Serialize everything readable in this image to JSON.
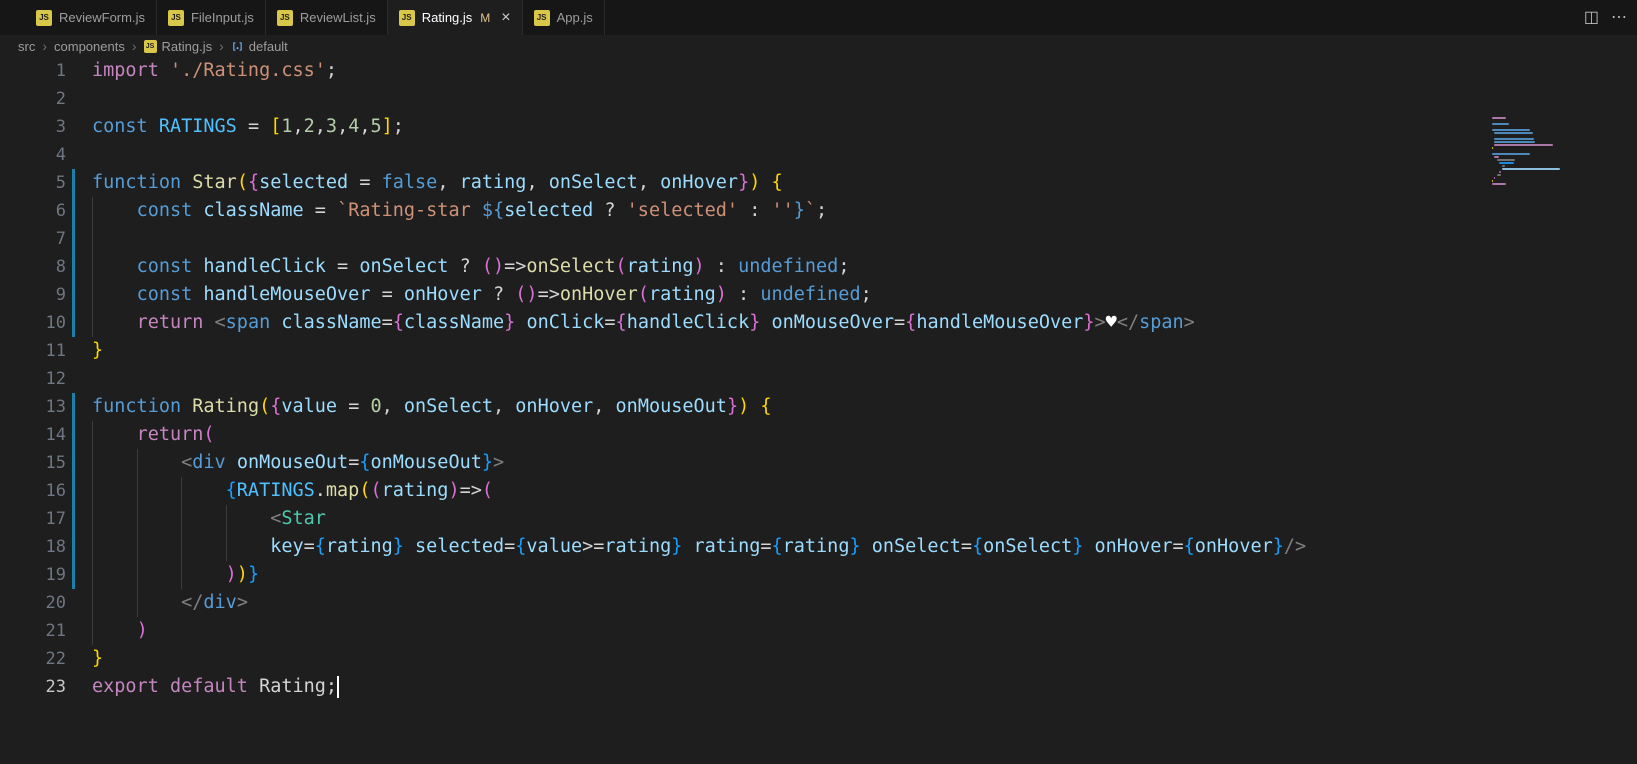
{
  "palette": {
    "ui": {
      "editor_bg": "#1e1e1e",
      "tabbar_bg": "#161616",
      "tab_active_bg": "#1e1e1e",
      "tab_border": "#2a2a2a",
      "tab_fg": "#9d9d9d",
      "tab_active_fg": "#ffffff",
      "modified": "#e2c08d",
      "breadcrumb_fg": "#9d9d9d",
      "breadcrumb_sep": "#6f6f6f",
      "line_no": "#6e7681",
      "line_no_active": "#c8c8c8",
      "guide": "#3b3b3b",
      "change_bar": "#1b81a8",
      "cursor": "#ffffff",
      "js_icon_bg": "#d9c749",
      "js_icon_fg": "#1e1e1e",
      "action_fg": "#bdbdbd",
      "symbol_icon": "#75beff"
    },
    "syntax": {
      "fg": "#d4d4d4",
      "kw1": "#c586c0",
      "kw2": "#569cd6",
      "fn": "#dcdcaa",
      "cmp": "#4ec9b0",
      "var": "#9cdcfe",
      "cnst": "#4fc1ff",
      "num": "#b5cea8",
      "str": "#ce9178",
      "tag": "#569cd6",
      "pk": "#808080",
      "b1": "#ffd700",
      "b2": "#da70d6",
      "b3": "#179fff",
      "hrt": "#ffffff"
    }
  },
  "tab_bar": {
    "icon_text": "JS",
    "tabs": [
      {
        "label": "ReviewForm.js",
        "active": false
      },
      {
        "label": "FileInput.js",
        "active": false
      },
      {
        "label": "ReviewList.js",
        "active": false
      },
      {
        "label": "Rating.js",
        "active": true,
        "git_status": "M",
        "close_glyph": "×"
      },
      {
        "label": "App.js",
        "active": false
      }
    ],
    "actions": [
      {
        "name": "split-editor-icon",
        "glyph": "◫"
      },
      {
        "name": "more-actions-icon",
        "glyph": "⋯"
      }
    ]
  },
  "breadcrumb": {
    "separator": "›",
    "items": [
      {
        "label": "src"
      },
      {
        "label": "components"
      },
      {
        "label": "Rating.js",
        "icon": "js"
      },
      {
        "label": "default",
        "icon": "symbol-variable"
      }
    ]
  },
  "editor": {
    "cursor": {
      "line": 23,
      "col": 22
    },
    "changed_lines": [
      5,
      6,
      7,
      8,
      9,
      10,
      13,
      14,
      15,
      16,
      17,
      18,
      19
    ],
    "lines": [
      {
        "n": 1,
        "guides": [],
        "tokens": [
          [
            "kw1",
            "import "
          ],
          [
            "str",
            "'./Rating.css'"
          ],
          [
            "fg",
            ";"
          ]
        ]
      },
      {
        "n": 2,
        "guides": [],
        "tokens": []
      },
      {
        "n": 3,
        "guides": [],
        "tokens": [
          [
            "kw2",
            "const "
          ],
          [
            "cnst",
            "RATINGS "
          ],
          [
            "fg",
            "= "
          ],
          [
            "b1",
            "["
          ],
          [
            "num",
            "1"
          ],
          [
            "fg",
            ","
          ],
          [
            "num",
            "2"
          ],
          [
            "fg",
            ","
          ],
          [
            "num",
            "3"
          ],
          [
            "fg",
            ","
          ],
          [
            "num",
            "4"
          ],
          [
            "fg",
            ","
          ],
          [
            "num",
            "5"
          ],
          [
            "b1",
            "]"
          ],
          [
            "fg",
            ";"
          ]
        ]
      },
      {
        "n": 4,
        "guides": [],
        "tokens": []
      },
      {
        "n": 5,
        "guides": [],
        "tokens": [
          [
            "kw2",
            "function "
          ],
          [
            "fn",
            "Star"
          ],
          [
            "b1",
            "("
          ],
          [
            "b2",
            "{"
          ],
          [
            "var",
            "selected"
          ],
          [
            "fg",
            " = "
          ],
          [
            "kw2",
            "false"
          ],
          [
            "fg",
            ", "
          ],
          [
            "var",
            "rating"
          ],
          [
            "fg",
            ", "
          ],
          [
            "var",
            "onSelect"
          ],
          [
            "fg",
            ", "
          ],
          [
            "var",
            "onHover"
          ],
          [
            "b2",
            "}"
          ],
          [
            "b1",
            ")"
          ],
          [
            "fg",
            " "
          ],
          [
            "b1",
            "{"
          ]
        ]
      },
      {
        "n": 6,
        "guides": [
          0
        ],
        "tokens": [
          [
            "fg",
            "    "
          ],
          [
            "kw2",
            "const "
          ],
          [
            "var",
            "className "
          ],
          [
            "fg",
            "= "
          ],
          [
            "str",
            "`Rating-star "
          ],
          [
            "kw2",
            "${"
          ],
          [
            "var",
            "selected "
          ],
          [
            "fg",
            "? "
          ],
          [
            "str",
            "'selected'"
          ],
          [
            "fg",
            " : "
          ],
          [
            "str",
            "''"
          ],
          [
            "kw2",
            "}"
          ],
          [
            "str",
            "`"
          ],
          [
            "fg",
            ";"
          ]
        ]
      },
      {
        "n": 7,
        "guides": [
          0
        ],
        "tokens": []
      },
      {
        "n": 8,
        "guides": [
          0
        ],
        "tokens": [
          [
            "fg",
            "    "
          ],
          [
            "kw2",
            "const "
          ],
          [
            "var",
            "handleClick "
          ],
          [
            "fg",
            "= "
          ],
          [
            "var",
            "onSelect "
          ],
          [
            "fg",
            "? "
          ],
          [
            "b2",
            "()"
          ],
          [
            "fg",
            "=>"
          ],
          [
            "fn",
            "onSelect"
          ],
          [
            "b2",
            "("
          ],
          [
            "var",
            "rating"
          ],
          [
            "b2",
            ")"
          ],
          [
            "fg",
            " : "
          ],
          [
            "kw2",
            "undefined"
          ],
          [
            "fg",
            ";"
          ]
        ]
      },
      {
        "n": 9,
        "guides": [
          0
        ],
        "tokens": [
          [
            "fg",
            "    "
          ],
          [
            "kw2",
            "const "
          ],
          [
            "var",
            "handleMouseOver "
          ],
          [
            "fg",
            "= "
          ],
          [
            "var",
            "onHover "
          ],
          [
            "fg",
            "? "
          ],
          [
            "b2",
            "()"
          ],
          [
            "fg",
            "=>"
          ],
          [
            "fn",
            "onHover"
          ],
          [
            "b2",
            "("
          ],
          [
            "var",
            "rating"
          ],
          [
            "b2",
            ")"
          ],
          [
            "fg",
            " : "
          ],
          [
            "kw2",
            "undefined"
          ],
          [
            "fg",
            ";"
          ]
        ]
      },
      {
        "n": 10,
        "guides": [
          0
        ],
        "tokens": [
          [
            "fg",
            "    "
          ],
          [
            "kw1",
            "return "
          ],
          [
            "pk",
            "<"
          ],
          [
            "tag",
            "span "
          ],
          [
            "var",
            "className"
          ],
          [
            "fg",
            "="
          ],
          [
            "b2",
            "{"
          ],
          [
            "var",
            "className"
          ],
          [
            "b2",
            "}"
          ],
          [
            "fg",
            " "
          ],
          [
            "var",
            "onClick"
          ],
          [
            "fg",
            "="
          ],
          [
            "b2",
            "{"
          ],
          [
            "var",
            "handleClick"
          ],
          [
            "b2",
            "}"
          ],
          [
            "fg",
            " "
          ],
          [
            "var",
            "onMouseOver"
          ],
          [
            "fg",
            "="
          ],
          [
            "b2",
            "{"
          ],
          [
            "var",
            "handleMouseOver"
          ],
          [
            "b2",
            "}"
          ],
          [
            "pk",
            ">"
          ],
          [
            "hrt",
            "♥"
          ],
          [
            "pk",
            "</"
          ],
          [
            "tag",
            "span"
          ],
          [
            "pk",
            ">"
          ]
        ]
      },
      {
        "n": 11,
        "guides": [],
        "tokens": [
          [
            "b1",
            "}"
          ]
        ]
      },
      {
        "n": 12,
        "guides": [],
        "tokens": []
      },
      {
        "n": 13,
        "guides": [],
        "tokens": [
          [
            "kw2",
            "function "
          ],
          [
            "fn",
            "Rating"
          ],
          [
            "b1",
            "("
          ],
          [
            "b2",
            "{"
          ],
          [
            "var",
            "value"
          ],
          [
            "fg",
            " = "
          ],
          [
            "num",
            "0"
          ],
          [
            "fg",
            ", "
          ],
          [
            "var",
            "onSelect"
          ],
          [
            "fg",
            ", "
          ],
          [
            "var",
            "onHover"
          ],
          [
            "fg",
            ", "
          ],
          [
            "var",
            "onMouseOut"
          ],
          [
            "b2",
            "}"
          ],
          [
            "b1",
            ")"
          ],
          [
            "fg",
            " "
          ],
          [
            "b1",
            "{"
          ]
        ]
      },
      {
        "n": 14,
        "guides": [
          0
        ],
        "tokens": [
          [
            "fg",
            "    "
          ],
          [
            "kw1",
            "return"
          ],
          [
            "b2",
            "("
          ]
        ]
      },
      {
        "n": 15,
        "guides": [
          0,
          4
        ],
        "tokens": [
          [
            "fg",
            "        "
          ],
          [
            "pk",
            "<"
          ],
          [
            "tag",
            "div "
          ],
          [
            "var",
            "onMouseOut"
          ],
          [
            "fg",
            "="
          ],
          [
            "b3",
            "{"
          ],
          [
            "var",
            "onMouseOut"
          ],
          [
            "b3",
            "}"
          ],
          [
            "pk",
            ">"
          ]
        ]
      },
      {
        "n": 16,
        "guides": [
          0,
          4,
          8
        ],
        "tokens": [
          [
            "fg",
            "            "
          ],
          [
            "b3",
            "{"
          ],
          [
            "cnst",
            "RATINGS"
          ],
          [
            "fg",
            "."
          ],
          [
            "fn",
            "map"
          ],
          [
            "b1",
            "("
          ],
          [
            "b2",
            "("
          ],
          [
            "var",
            "rating"
          ],
          [
            "b2",
            ")"
          ],
          [
            "fg",
            "=>"
          ],
          [
            "b2",
            "("
          ]
        ]
      },
      {
        "n": 17,
        "guides": [
          0,
          4,
          8,
          12
        ],
        "tokens": [
          [
            "fg",
            "                "
          ],
          [
            "pk",
            "<"
          ],
          [
            "cmp",
            "Star"
          ]
        ]
      },
      {
        "n": 18,
        "guides": [
          0,
          4,
          8,
          12
        ],
        "tokens": [
          [
            "fg",
            "                "
          ],
          [
            "var",
            "key"
          ],
          [
            "fg",
            "="
          ],
          [
            "b3",
            "{"
          ],
          [
            "var",
            "rating"
          ],
          [
            "b3",
            "}"
          ],
          [
            "fg",
            " "
          ],
          [
            "var",
            "selected"
          ],
          [
            "fg",
            "="
          ],
          [
            "b3",
            "{"
          ],
          [
            "var",
            "value"
          ],
          [
            "fg",
            ">="
          ],
          [
            "var",
            "rating"
          ],
          [
            "b3",
            "}"
          ],
          [
            "fg",
            " "
          ],
          [
            "var",
            "rating"
          ],
          [
            "fg",
            "="
          ],
          [
            "b3",
            "{"
          ],
          [
            "var",
            "rating"
          ],
          [
            "b3",
            "}"
          ],
          [
            "fg",
            " "
          ],
          [
            "var",
            "onSelect"
          ],
          [
            "fg",
            "="
          ],
          [
            "b3",
            "{"
          ],
          [
            "var",
            "onSelect"
          ],
          [
            "b3",
            "}"
          ],
          [
            "fg",
            " "
          ],
          [
            "var",
            "onHover"
          ],
          [
            "fg",
            "="
          ],
          [
            "b3",
            "{"
          ],
          [
            "var",
            "onHover"
          ],
          [
            "b3",
            "}"
          ],
          [
            "pk",
            "/>"
          ]
        ]
      },
      {
        "n": 19,
        "guides": [
          0,
          4,
          8
        ],
        "tokens": [
          [
            "fg",
            "            "
          ],
          [
            "b2",
            ")"
          ],
          [
            "b1",
            ")"
          ],
          [
            "b3",
            "}"
          ]
        ]
      },
      {
        "n": 20,
        "guides": [
          0,
          4
        ],
        "tokens": [
          [
            "fg",
            "        "
          ],
          [
            "pk",
            "</"
          ],
          [
            "tag",
            "div"
          ],
          [
            "pk",
            ">"
          ]
        ]
      },
      {
        "n": 21,
        "guides": [
          0
        ],
        "tokens": [
          [
            "fg",
            "    "
          ],
          [
            "b2",
            ")"
          ]
        ]
      },
      {
        "n": 22,
        "guides": [],
        "tokens": [
          [
            "b1",
            "}"
          ]
        ]
      },
      {
        "n": 23,
        "guides": [],
        "tokens": [
          [
            "kw1",
            "export default "
          ],
          [
            "fg",
            "Rating;"
          ]
        ]
      }
    ]
  }
}
